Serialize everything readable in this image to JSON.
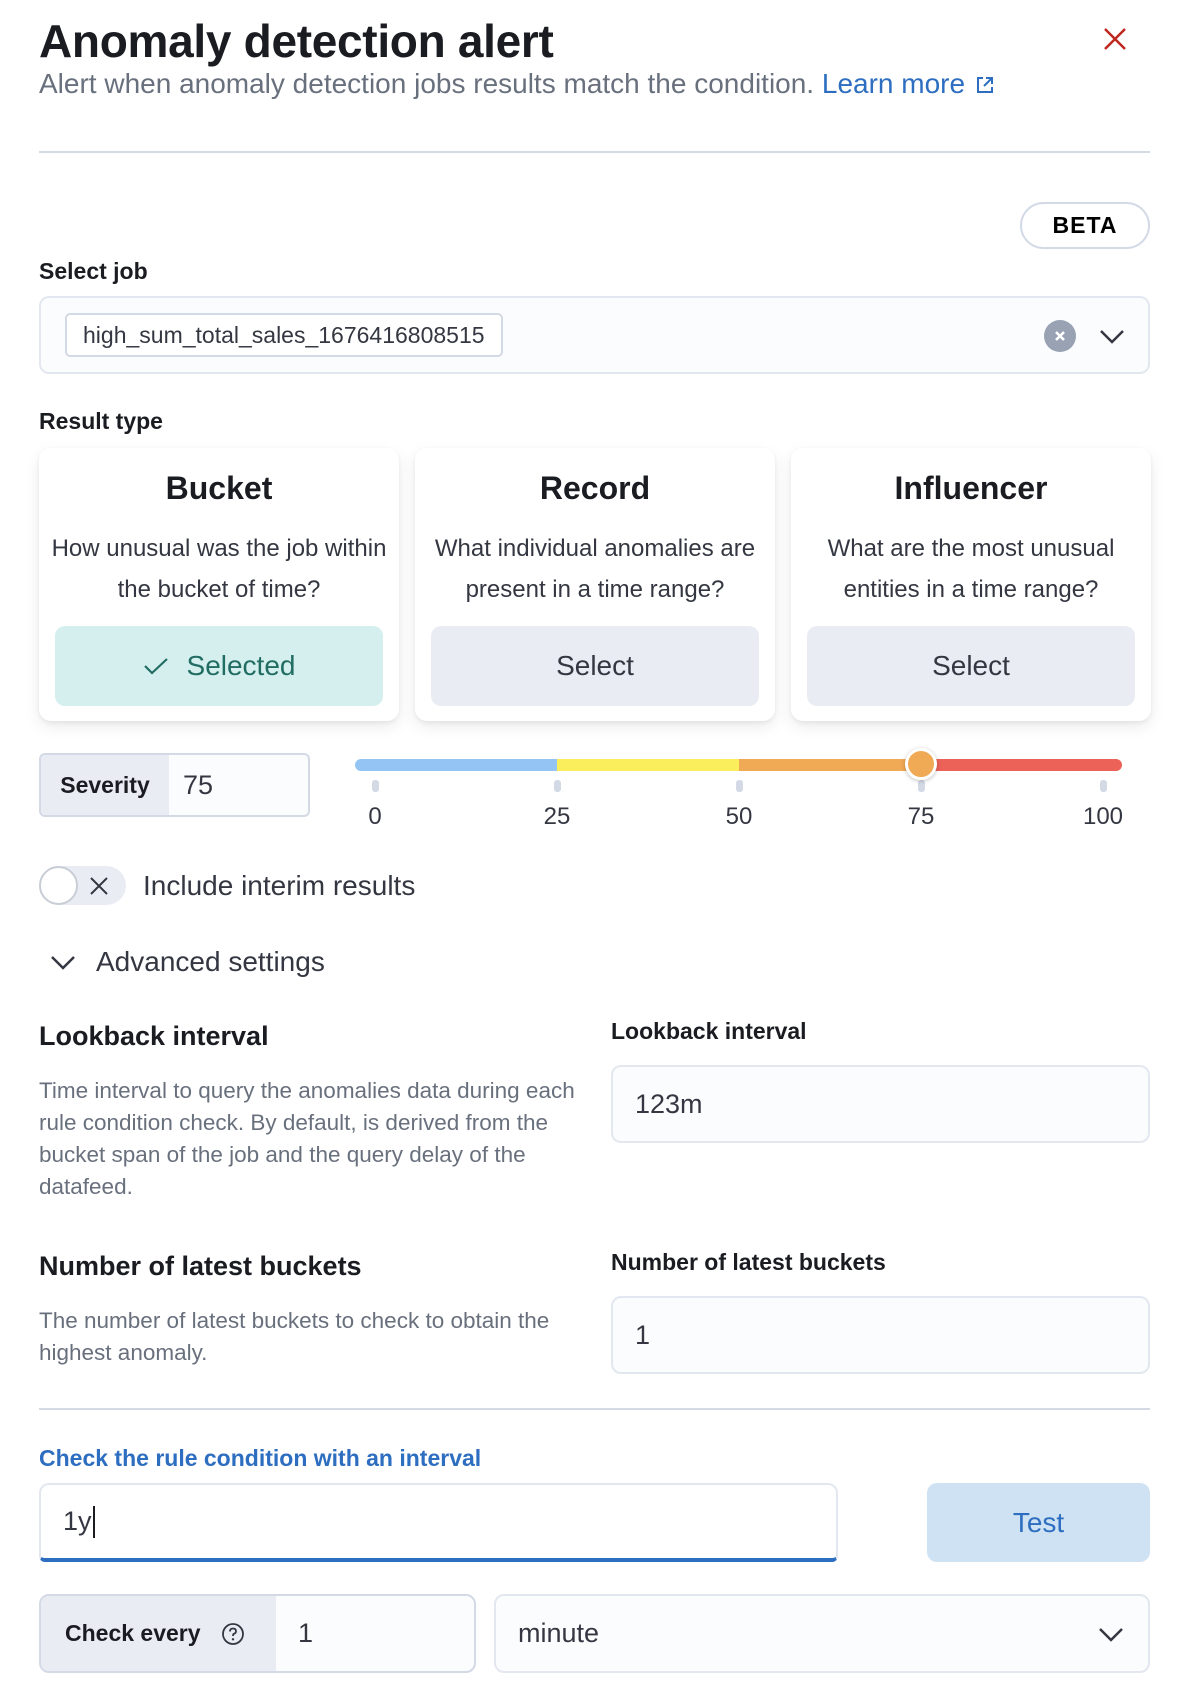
{
  "header": {
    "title": "Anomaly detection alert",
    "subtitle": "Alert when anomaly detection jobs results match the condition.",
    "learn_more": "Learn more",
    "close_icon": "close-icon",
    "external_icon": "external-link-icon"
  },
  "badge": "BETA",
  "job": {
    "label": "Select job",
    "selected": "high_sum_total_sales_1676416808515"
  },
  "result_type": {
    "label": "Result type",
    "options": [
      {
        "title": "Bucket",
        "description": "How unusual was the job within the bucket of time?",
        "button": "Selected",
        "selected": true
      },
      {
        "title": "Record",
        "description": "What individual anomalies are present in a time range?",
        "button": "Select",
        "selected": false
      },
      {
        "title": "Influencer",
        "description": "What are the most unusual entities in a time range?",
        "button": "Select",
        "selected": false
      }
    ]
  },
  "severity": {
    "label": "Severity",
    "value": "75",
    "slider_value": 75,
    "min": 0,
    "max": 100,
    "ticks": [
      "0",
      "25",
      "50",
      "75",
      "100"
    ],
    "ranges": [
      {
        "from": 0,
        "to": 25,
        "color": "#94c4f4"
      },
      {
        "from": 25,
        "to": 50,
        "color": "#fbee5c"
      },
      {
        "from": 50,
        "to": 75,
        "color": "#f0a955"
      },
      {
        "from": 75,
        "to": 100,
        "color": "#ec6158"
      }
    ]
  },
  "interim": {
    "label": "Include interim results",
    "checked": false
  },
  "advanced": {
    "label": "Advanced settings",
    "expanded": true
  },
  "lookback": {
    "title": "Lookback interval",
    "description": "Time interval to query the anomalies data during each rule condition check. By default, is derived from the bucket span of the job and the query delay of the datafeed.",
    "field_label": "Lookback interval",
    "value": "123m"
  },
  "buckets": {
    "title": "Number of latest buckets",
    "description": "The number of latest buckets to check to obtain the highest anomaly.",
    "field_label": "Number of latest buckets",
    "value": "1"
  },
  "interval_check": {
    "label": "Check the rule condition with an interval",
    "value": "1y",
    "test_button": "Test"
  },
  "check_every": {
    "label": "Check every",
    "value": "1",
    "unit": "minute"
  }
}
